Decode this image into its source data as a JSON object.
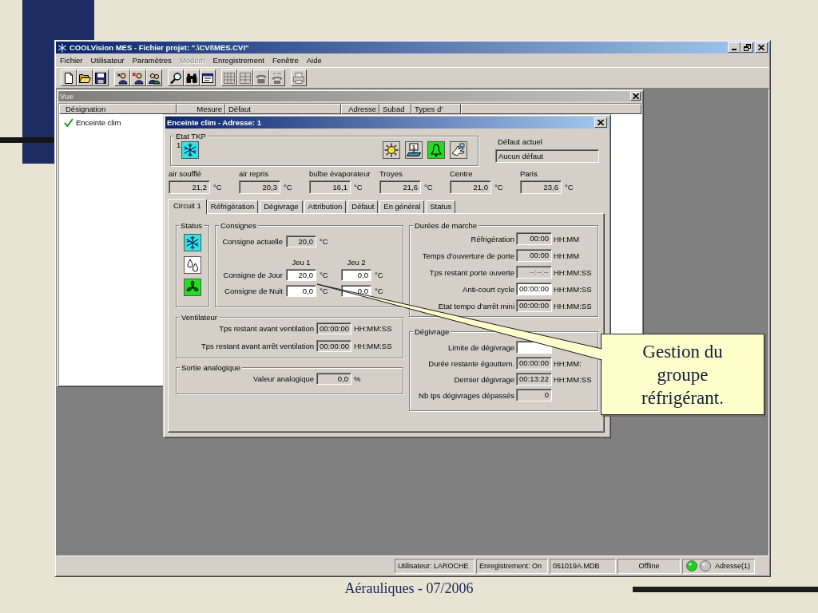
{
  "slide": {
    "footer": "Aérauliques - 07/2006"
  },
  "window": {
    "title": "COOLVision MES - Fichier projet: \".\\CVI\\MES.CVI\"",
    "active": true
  },
  "menu": [
    {
      "label": "Fichier",
      "disabled": false
    },
    {
      "label": "Utilisateur",
      "disabled": false
    },
    {
      "label": "Paramètres",
      "disabled": false
    },
    {
      "label": "Modem",
      "disabled": true
    },
    {
      "label": "Enregistrement",
      "disabled": false
    },
    {
      "label": "Fenêtre",
      "disabled": false
    },
    {
      "label": "Aide",
      "disabled": false
    }
  ],
  "toolbar": [
    {
      "buttons": [
        {
          "disabled": false
        },
        {
          "disabled": false
        },
        {
          "disabled": false
        }
      ]
    },
    {
      "buttons": [
        {
          "disabled": false
        },
        {
          "disabled": false
        },
        {
          "disabled": false
        }
      ]
    },
    {
      "buttons": [
        {
          "disabled": false
        },
        {
          "disabled": false
        },
        {
          "disabled": false
        }
      ]
    },
    {
      "buttons": [
        {
          "disabled": true
        },
        {
          "disabled": true
        },
        {
          "disabled": true
        },
        {
          "disabled": true
        }
      ]
    },
    {
      "buttons": [
        {
          "disabled": true
        }
      ]
    }
  ],
  "vue": {
    "title": "Vue",
    "active": false,
    "columns": [
      "Désignation",
      "Mesure",
      "Défaut",
      "Adresse",
      "Subad",
      "Types d'"
    ],
    "rows": [
      {
        "designation": "Enceinte clim",
        "ok": true
      }
    ]
  },
  "dialog": {
    "title": "Enceinte clim - Adresse: 1",
    "active": true,
    "etat_tkp": {
      "label": "Etat TKP",
      "number": "1",
      "mode": {
        "on": true
      },
      "indicators": [
        {
          "on": false
        },
        {
          "on": false,
          "text": "1"
        },
        {
          "on": true
        },
        {
          "on": false
        }
      ]
    },
    "defaut_actuel": {
      "label": "Défaut actuel",
      "value": "Aucun défaut"
    },
    "measures": [
      {
        "label": "air soufflé",
        "value": "21,2",
        "unit": "°C"
      },
      {
        "label": "air repris",
        "value": "20,3",
        "unit": "°C"
      },
      {
        "label": "bulbe évaporateur",
        "value": "16,1",
        "unit": "°C"
      },
      {
        "label": "Troyes",
        "value": "21,6",
        "unit": "°C"
      },
      {
        "label": "Centre",
        "value": "21,0",
        "unit": "°C"
      },
      {
        "label": "Paris",
        "value": "23,6",
        "unit": "°C"
      }
    ],
    "tabs": [
      {
        "label": "Circuit 1",
        "selected": true
      },
      {
        "label": "Réfrigération",
        "selected": false
      },
      {
        "label": "Dégivrage",
        "selected": false
      },
      {
        "label": "Attribution",
        "selected": false
      },
      {
        "label": "Défaut",
        "selected": false
      },
      {
        "label": "En général",
        "selected": false
      },
      {
        "label": "Status",
        "selected": false
      }
    ],
    "status": {
      "label": "Status",
      "icons": [
        {
          "on": true
        },
        {
          "on": false
        },
        {
          "on": true
        }
      ]
    },
    "consignes": {
      "label": "Consignes",
      "current": {
        "label": "Consigne actuelle",
        "value": "20,0",
        "unit": "°C",
        "editable": false
      },
      "columns": [
        "Jeu 1",
        "Jeu 2"
      ],
      "rows": [
        {
          "label": "Consigne de Jour",
          "cells": [
            {
              "value": "20,0",
              "unit": "°C",
              "editable": true
            },
            {
              "value": "0,0",
              "unit": "°C",
              "editable": true
            }
          ]
        },
        {
          "label": "Consigne de Nuit",
          "cells": [
            {
              "value": "0,0",
              "unit": "°C",
              "editable": true
            },
            {
              "value": "0,0",
              "unit": "°C",
              "editable": true
            }
          ]
        }
      ]
    },
    "ventilateur": {
      "label": "Ventilateur",
      "rows": [
        {
          "label": "Tps restant avant ventilation",
          "value": "00:00:00",
          "unit": "HH:MM:SS",
          "editable": false
        },
        {
          "label": "Tps restant avant arrêt ventilation",
          "value": "00:00:00",
          "unit": "HH:MM:SS",
          "editable": false
        }
      ]
    },
    "sortie_analogique": {
      "label": "Sortie analogique",
      "rows": [
        {
          "label": "Valeur analogique",
          "value": "0,0",
          "unit": "%",
          "editable": false
        }
      ]
    },
    "durees_de_marche": {
      "label": "Durées de marche",
      "rows": [
        {
          "label": "Réfrigération",
          "value": "00:00",
          "unit": "HH:MM",
          "editable": false,
          "disabled": false
        },
        {
          "label": "Temps d'ouverture de porte",
          "value": "00:00",
          "unit": "HH:MM",
          "editable": false,
          "disabled": false
        },
        {
          "label": "Tps restant porte ouverte",
          "value": "--:--:--",
          "unit": "HH:MM:SS",
          "editable": false,
          "disabled": true
        },
        {
          "label": "Anti-court cycle",
          "value": "00:00:00",
          "unit": "HH:MM:SS",
          "editable": true,
          "disabled": false
        },
        {
          "label": "Etat tempo d'arrêt mini",
          "value": "00:00:00",
          "unit": "HH:MM:SS",
          "editable": false,
          "disabled": false
        }
      ]
    },
    "degivrage": {
      "label": "Dégivrage",
      "rows": [
        {
          "label": "Limite de dégivrage",
          "editable": true
        },
        {
          "label": "Durée restante égouttem.",
          "value": "00:00:00",
          "unit": "HH:MM:",
          "editable": false
        },
        {
          "label": "Dernier dégivrage",
          "value": "00:13:22",
          "unit": "HH:MM:SS",
          "editable": false
        },
        {
          "label": "Nb tps dégivrages dépassés",
          "value": "0",
          "editable": false
        }
      ]
    }
  },
  "status_bar": {
    "panels": [
      "Utilisateur: LAROCHE",
      "Enregistrement: On",
      "051019A.MDB",
      "Offline"
    ],
    "lights": [
      {
        "on": true
      },
      {
        "on": false
      }
    ],
    "address": "Adresse(1)"
  },
  "callout": {
    "text": "Gestion du groupe réfrigérant."
  }
}
